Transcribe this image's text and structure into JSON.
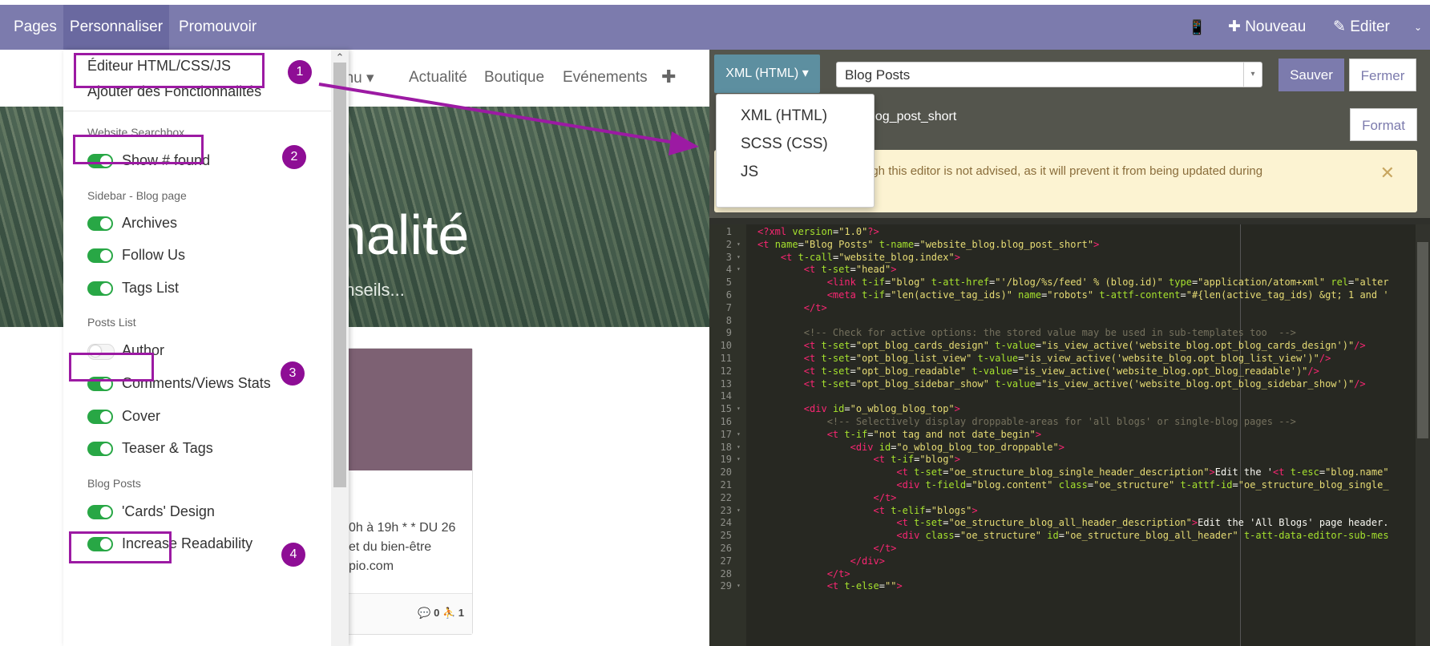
{
  "topbar": {
    "pages": "Pages",
    "personnaliser": "Personnaliser",
    "promouvoir": "Promouvoir",
    "mobile_icon": "📱",
    "nouveau": "✚ Nouveau",
    "editer": "✎ Editer",
    "caret": "⌄"
  },
  "site": {
    "nav_menu": "enu ▾",
    "nav_actualite": "Actualité",
    "nav_boutique": "Boutique",
    "nav_evenements": "Evénements",
    "nav_plus": "✚",
    "hero_title": "nalité",
    "hero_subtitle": "onseils...",
    "card_text": "0h à 19h * * DU 26 et du bien-être pio.com",
    "card_stats": "💬 0  ⛹ 1"
  },
  "customize_menu": {
    "html_editor": "Éditeur HTML/CSS/JS",
    "add_features": "Ajouter des Fonctionnalités",
    "website_searchbox": "Website Searchbox",
    "show_found": "Show # found",
    "sidebar_blog_page": "Sidebar - Blog page",
    "archives": "Archives",
    "follow_us": "Follow Us",
    "tags_list": "Tags List",
    "posts_list": "Posts List",
    "author": "Author",
    "comments_views": "Comments/Views Stats",
    "cover": "Cover",
    "teaser_tags": "Teaser & Tags",
    "blog_posts": "Blog Posts",
    "cards_design": "'Cards' Design",
    "increase_readability": "Increase Readability",
    "scroll_up": "⌃"
  },
  "toggles": {
    "show_found": true,
    "archives": true,
    "follow_us": true,
    "tags_list": true,
    "author": false,
    "comments_views": true,
    "cover": true,
    "teaser_tags": true,
    "cards_design": true,
    "increase_readability": true
  },
  "badges": [
    "1",
    "2",
    "3",
    "4"
  ],
  "editor": {
    "type_button": "XML (HTML) ▾",
    "template_select": "Blog Posts",
    "select_arrow": "▾",
    "save": "Sauver",
    "close": "Fermer",
    "template_key": ".blog_post_short",
    "format": "Format",
    "warning": "ugh this editor is not advised, as it will prevent it from being updated during",
    "warning_close": "✕",
    "lang_options": [
      "XML (HTML)",
      "SCSS (CSS)",
      "JS"
    ]
  },
  "code_lines": [
    {
      "n": "1",
      "f": "",
      "h": "<span class=\"tg\">&lt;?xml</span> <span class=\"at\">version</span>=<span class=\"st\">\"1.0\"</span><span class=\"tg\">?&gt;</span>"
    },
    {
      "n": "2",
      "f": "▾",
      "h": "<span class=\"tg\">&lt;t</span> <span class=\"at\">name</span>=<span class=\"st\">\"Blog Posts\"</span> <span class=\"at\">t-name</span>=<span class=\"st\">\"website_blog.blog_post_short\"</span><span class=\"tg\">&gt;</span>"
    },
    {
      "n": "3",
      "f": "▾",
      "h": "    <span class=\"tg\">&lt;t</span> <span class=\"at\">t-call</span>=<span class=\"st\">\"website_blog.index\"</span><span class=\"tg\">&gt;</span>"
    },
    {
      "n": "4",
      "f": "▾",
      "h": "        <span class=\"tg\">&lt;t</span> <span class=\"at\">t-set</span>=<span class=\"st\">\"head\"</span><span class=\"tg\">&gt;</span>"
    },
    {
      "n": "5",
      "f": "",
      "h": "            <span class=\"tg\">&lt;link</span> <span class=\"at\">t-if</span>=<span class=\"st\">\"blog\"</span> <span class=\"at\">t-att-href</span>=<span class=\"st\">\"'/blog/%s/feed' % (blog.id)\"</span> <span class=\"at\">type</span>=<span class=\"st\">\"application/atom+xml\"</span> <span class=\"at\">rel</span>=<span class=\"st\">\"alter</span>"
    },
    {
      "n": "6",
      "f": "",
      "h": "            <span class=\"tg\">&lt;meta</span> <span class=\"at\">t-if</span>=<span class=\"st\">\"len(active_tag_ids)\"</span> <span class=\"at\">name</span>=<span class=\"st\">\"robots\"</span> <span class=\"at\">t-attf-content</span>=<span class=\"st\">\"#{len(active_tag_ids) &amp;gt; 1 and '</span>"
    },
    {
      "n": "7",
      "f": "",
      "h": "        <span class=\"tg\">&lt;/t&gt;</span>"
    },
    {
      "n": "8",
      "f": "",
      "h": ""
    },
    {
      "n": "9",
      "f": "",
      "h": "        <span class=\"cm\">&lt;!-- Check for active options: the stored value may be used in sub-templates too  --&gt;</span>"
    },
    {
      "n": "10",
      "f": "",
      "h": "        <span class=\"tg\">&lt;t</span> <span class=\"at\">t-set</span>=<span class=\"st\">\"opt_blog_cards_design\"</span> <span class=\"at\">t-value</span>=<span class=\"st\">\"is_view_active('website_blog.opt_blog_cards_design')\"</span><span class=\"tg\">/&gt;</span>"
    },
    {
      "n": "11",
      "f": "",
      "h": "        <span class=\"tg\">&lt;t</span> <span class=\"at\">t-set</span>=<span class=\"st\">\"opt_blog_list_view\"</span> <span class=\"at\">t-value</span>=<span class=\"st\">\"is_view_active('website_blog.opt_blog_list_view')\"</span><span class=\"tg\">/&gt;</span>"
    },
    {
      "n": "12",
      "f": "",
      "h": "        <span class=\"tg\">&lt;t</span> <span class=\"at\">t-set</span>=<span class=\"st\">\"opt_blog_readable\"</span> <span class=\"at\">t-value</span>=<span class=\"st\">\"is_view_active('website_blog.opt_blog_readable')\"</span><span class=\"tg\">/&gt;</span>"
    },
    {
      "n": "13",
      "f": "",
      "h": "        <span class=\"tg\">&lt;t</span> <span class=\"at\">t-set</span>=<span class=\"st\">\"opt_blog_sidebar_show\"</span> <span class=\"at\">t-value</span>=<span class=\"st\">\"is_view_active('website_blog.opt_blog_sidebar_show')\"</span><span class=\"tg\">/&gt;</span>"
    },
    {
      "n": "14",
      "f": "",
      "h": ""
    },
    {
      "n": "15",
      "f": "▾",
      "h": "        <span class=\"tg\">&lt;div</span> <span class=\"at\">id</span>=<span class=\"st\">\"o_wblog_blog_top\"</span><span class=\"tg\">&gt;</span>"
    },
    {
      "n": "16",
      "f": "",
      "h": "            <span class=\"cm\">&lt;!-- Selectively display droppable-areas for 'all blogs' or single-blog pages --&gt;</span>"
    },
    {
      "n": "17",
      "f": "▾",
      "h": "            <span class=\"tg\">&lt;t</span> <span class=\"at\">t-if</span>=<span class=\"st\">\"not tag and not date_begin\"</span><span class=\"tg\">&gt;</span>"
    },
    {
      "n": "18",
      "f": "▾",
      "h": "                <span class=\"tg\">&lt;div</span> <span class=\"at\">id</span>=<span class=\"st\">\"o_wblog_blog_top_droppable\"</span><span class=\"tg\">&gt;</span>"
    },
    {
      "n": "19",
      "f": "▾",
      "h": "                    <span class=\"tg\">&lt;t</span> <span class=\"at\">t-if</span>=<span class=\"st\">\"blog\"</span><span class=\"tg\">&gt;</span>"
    },
    {
      "n": "20",
      "f": "",
      "h": "                        <span class=\"tg\">&lt;t</span> <span class=\"at\">t-set</span>=<span class=\"st\">\"oe_structure_blog_single_header_description\"</span><span class=\"tg\">&gt;</span>Edit the '<span class=\"tg\">&lt;t</span> <span class=\"at\">t-esc</span>=<span class=\"st\">\"blog.name\"</span>"
    },
    {
      "n": "21",
      "f": "",
      "h": "                        <span class=\"tg\">&lt;div</span> <span class=\"at\">t-field</span>=<span class=\"st\">\"blog.content\"</span> <span class=\"at\">class</span>=<span class=\"st\">\"oe_structure\"</span> <span class=\"at\">t-attf-id</span>=<span class=\"st\">\"oe_structure_blog_single_</span>"
    },
    {
      "n": "22",
      "f": "",
      "h": "                    <span class=\"tg\">&lt;/t&gt;</span>"
    },
    {
      "n": "23",
      "f": "▾",
      "h": "                    <span class=\"tg\">&lt;t</span> <span class=\"at\">t-elif</span>=<span class=\"st\">\"blogs\"</span><span class=\"tg\">&gt;</span>"
    },
    {
      "n": "24",
      "f": "",
      "h": "                        <span class=\"tg\">&lt;t</span> <span class=\"at\">t-set</span>=<span class=\"st\">\"oe_structure_blog_all_header_description\"</span><span class=\"tg\">&gt;</span>Edit the 'All Blogs' page header."
    },
    {
      "n": "25",
      "f": "",
      "h": "                        <span class=\"tg\">&lt;div</span> <span class=\"at\">class</span>=<span class=\"st\">\"oe_structure\"</span> <span class=\"at\">id</span>=<span class=\"st\">\"oe_structure_blog_all_header\"</span> <span class=\"at\">t-att-data-editor-sub-mes</span>"
    },
    {
      "n": "26",
      "f": "",
      "h": "                    <span class=\"tg\">&lt;/t&gt;</span>"
    },
    {
      "n": "27",
      "f": "",
      "h": "                <span class=\"tg\">&lt;/div&gt;</span>"
    },
    {
      "n": "28",
      "f": "",
      "h": "            <span class=\"tg\">&lt;/t&gt;</span>"
    },
    {
      "n": "29",
      "f": "▾",
      "h": "            <span class=\"tg\">&lt;t</span> <span class=\"at\">t-else</span>=<span class=\"st\">\"\"</span><span class=\"tg\">&gt;</span>"
    }
  ],
  "colors": {
    "navbar": "#7c7bad",
    "navbar_active": "#6a69a0",
    "highlight": "#9c1aa3",
    "toggle_on": "#28a745",
    "editor_bg": "#272822"
  }
}
